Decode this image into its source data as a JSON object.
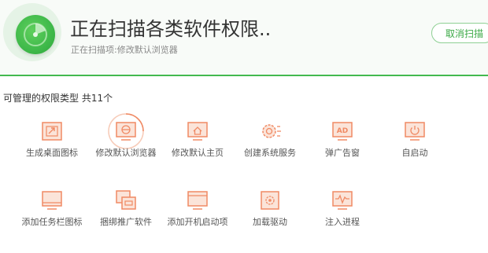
{
  "header": {
    "title": "正在扫描各类软件权限..",
    "subtitle": "正在扫描项:修改默认浏览器",
    "cancel_label": "取消扫描",
    "accent_color": "#43b94f"
  },
  "section": {
    "title": "可管理的权限类型 共11个"
  },
  "permissions": [
    {
      "label": "生成桌面图标",
      "icon": "desktop-shortcut-icon"
    },
    {
      "label": "修改默认浏览器",
      "icon": "browser-icon",
      "active": true
    },
    {
      "label": "修改默认主页",
      "icon": "homepage-icon"
    },
    {
      "label": "创建系统服务",
      "icon": "system-service-icon"
    },
    {
      "label": "弹广告窗",
      "icon": "ad-popup-icon"
    },
    {
      "label": "自启动",
      "icon": "autostart-icon"
    },
    {
      "label": "添加任务栏图标",
      "icon": "taskbar-icon"
    },
    {
      "label": "捆绑推广软件",
      "icon": "bundled-software-icon"
    },
    {
      "label": "添加开机启动项",
      "icon": "boot-item-icon"
    },
    {
      "label": "加载驱动",
      "icon": "driver-icon"
    },
    {
      "label": "注入进程",
      "icon": "inject-process-icon"
    }
  ],
  "icon_badge": "AD",
  "icon_color": "#f08a64",
  "icon_fill": "#fbe4d9"
}
